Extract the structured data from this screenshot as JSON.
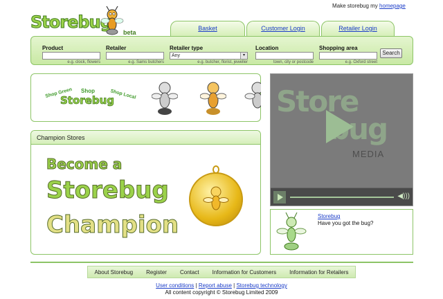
{
  "header": {
    "make_prefix": "Make storebug my",
    "make_link": "homepage",
    "logo_text": "Storebug",
    "logo_badge": "beta"
  },
  "tabs": [
    {
      "label": "Basket"
    },
    {
      "label": "Customer Login"
    },
    {
      "label": "Retailer Login"
    }
  ],
  "search": {
    "fields": [
      {
        "label": "Product",
        "value": "",
        "hint": "e.g. clock, flowers"
      },
      {
        "label": "Retailer",
        "value": "",
        "hint": "e.g. Sams butchers"
      },
      {
        "label": "Retailer type",
        "value": "Any",
        "hint": "e.g. butcher, florist, jeweller"
      },
      {
        "label": "Location",
        "value": "",
        "hint": "town, city or postcode"
      },
      {
        "label": "Shopping area",
        "value": "",
        "hint": "e.g. Oxford street"
      }
    ],
    "button": "Search"
  },
  "banner": {
    "shop_green": "Shop Green",
    "shop": "Shop",
    "storebug": "Storebug",
    "shop_local": "Shop Local"
  },
  "media": {
    "logo_line1": "Store",
    "logo_line2": "bug",
    "word": "MEDIA",
    "vol": "◀)))"
  },
  "champion": {
    "heading": "Champion Stores",
    "line1": "Become a",
    "line2": "Storebug",
    "line3": "Champion"
  },
  "bugbox": {
    "name": "Storebug",
    "text": "Have you got the bug?"
  },
  "footer": {
    "nav": [
      "About Storebug",
      "Register",
      "Contact",
      "Information for Customers",
      "Information for Retailers"
    ],
    "links": [
      "User conditions",
      "Report abuse",
      "Storebug technology"
    ],
    "sep": "|",
    "copyright": "All content copyright © Storebug Limited 2009"
  },
  "colors": {
    "accent_green": "#8cc466",
    "link_blue": "#1a3cc8"
  }
}
